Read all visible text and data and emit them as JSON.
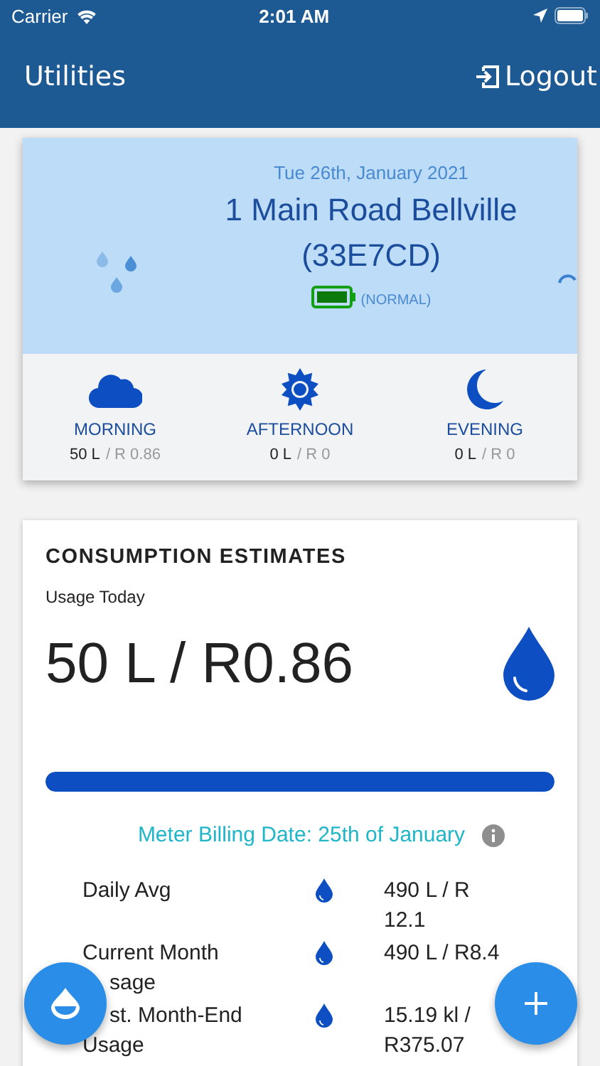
{
  "status_bar": {
    "carrier": "Carrier",
    "time": "2:01 AM"
  },
  "header": {
    "title": "Utilities",
    "logout": "Logout"
  },
  "meter_card": {
    "date": "Tue 26th, January 2021",
    "address": "1 Main Road Bellville",
    "meter_id": "(33E7CD)",
    "battery_status": "(NORMAL)",
    "periods": [
      {
        "kind": "cloud",
        "label": "MORNING",
        "litres": "50 L",
        "cost": "/ R 0.86"
      },
      {
        "kind": "sun",
        "label": "AFTERNOON",
        "litres": "0 L",
        "cost": "/ R 0"
      },
      {
        "kind": "moon",
        "label": "EVENING",
        "litres": "0 L",
        "cost": "/ R 0"
      }
    ]
  },
  "consumption": {
    "title": "CONSUMPTION ESTIMATES",
    "subtitle": "Usage Today",
    "usage": "50 L / R0.86",
    "level": 1,
    "billing_date": "Meter Billing Date: 25th of January",
    "rows": [
      {
        "label_lines": [
          {
            "text": "Daily Avg",
            "covered": false
          }
        ],
        "value": "490 L / R\n12.1"
      },
      {
        "label_lines": [
          {
            "text": "Current Month",
            "covered": false
          },
          {
            "text": "sage",
            "covered": true
          }
        ],
        "value": "490 L / R8.4"
      },
      {
        "label_lines": [
          {
            "text": "st. Month-End",
            "covered": true
          },
          {
            "text": "Usage",
            "covered": false
          }
        ],
        "value": "15.19 kl /\nR375.07"
      }
    ]
  }
}
